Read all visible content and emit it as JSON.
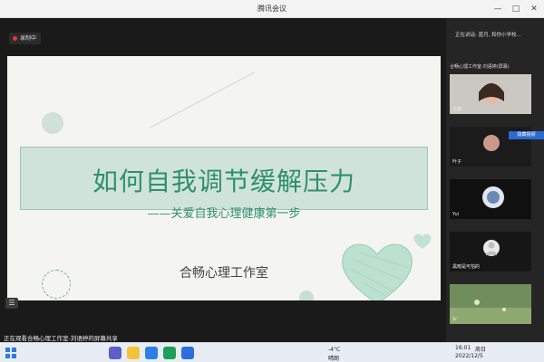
{
  "window": {
    "title": "腾讯会议"
  },
  "window_controls": {
    "min": "—",
    "max": "□",
    "close": "✕"
  },
  "recording": {
    "label": "录制中"
  },
  "slide": {
    "title": "如何自我调节缓解压力",
    "subtitle": "——关爱自我心理健康第一步",
    "org": "合畅心理工作室"
  },
  "share_bar": {
    "label": "正在观看合畅心理工作室-刘语婷的屏幕共享"
  },
  "menu_button": {
    "label": "☰"
  },
  "right_panel": {
    "top_text": "正在讲话: 蓝月, 和你小学校...",
    "tag": "隐藏视频",
    "participants": [
      {
        "name": "合畅心理工作室-刘语婷(屏幕)"
      },
      {
        "name": "王丽"
      },
      {
        "name": "叶子"
      },
      {
        "name": "Yui"
      },
      {
        "name": "黑暗是可怕的"
      },
      {
        "name": "Sr"
      }
    ]
  },
  "taskbar": {
    "temperature": "-4°C",
    "weather": "晴朗",
    "time": "16:01",
    "weekday": "周日",
    "date": "2022/12/5"
  }
}
